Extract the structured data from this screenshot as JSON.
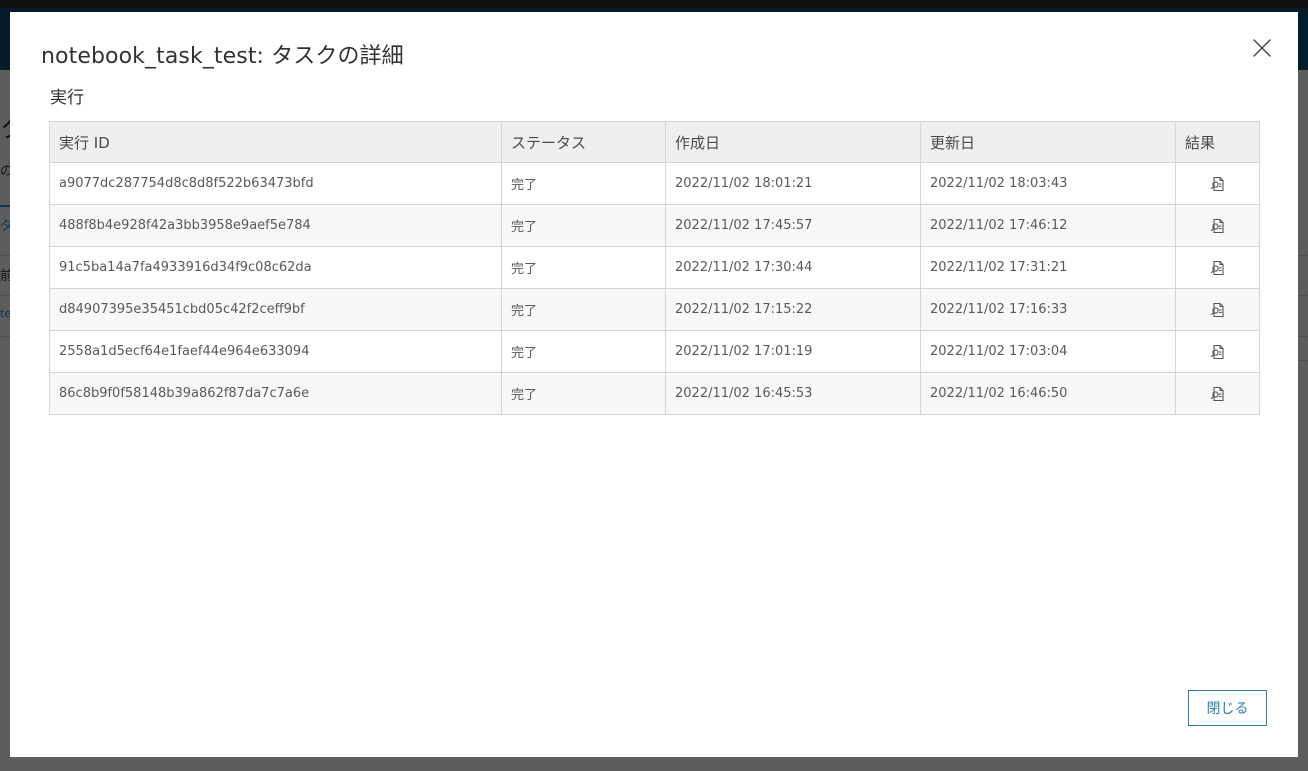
{
  "background": {
    "left_fragments": [
      "ク",
      "の",
      "タ",
      "前",
      "te"
    ]
  },
  "dialog": {
    "title": "notebook_task_test: タスクの詳細",
    "close_icon": "close-icon",
    "section_label": "実行",
    "table": {
      "headers": {
        "run_id": "実行 ID",
        "status": "ステータス",
        "created": "作成日",
        "updated": "更新日",
        "result": "結果"
      },
      "result_icon": "view-result-icon",
      "rows": [
        {
          "run_id": "a9077dc287754d8c8d8f522b63473bfd",
          "status": "完了",
          "created": "2022/11/02 18:01:21",
          "updated": "2022/11/02 18:03:43"
        },
        {
          "run_id": "488f8b4e928f42a3bb3958e9aef5e784",
          "status": "完了",
          "created": "2022/11/02 17:45:57",
          "updated": "2022/11/02 17:46:12"
        },
        {
          "run_id": "91c5ba14a7fa4933916d34f9c08c62da",
          "status": "完了",
          "created": "2022/11/02 17:30:44",
          "updated": "2022/11/02 17:31:21"
        },
        {
          "run_id": "d84907395e35451cbd05c42f2ceff9bf",
          "status": "完了",
          "created": "2022/11/02 17:15:22",
          "updated": "2022/11/02 17:16:33"
        },
        {
          "run_id": "2558a1d5ecf64e1faef44e964e633094",
          "status": "完了",
          "created": "2022/11/02 17:01:19",
          "updated": "2022/11/02 17:03:04"
        },
        {
          "run_id": "86c8b9f0f58148b39a862f87da7c7a6e",
          "status": "完了",
          "created": "2022/11/02 16:45:53",
          "updated": "2022/11/02 16:46:50"
        }
      ]
    },
    "close_button_label": "閉じる",
    "colors": {
      "accent": "#2f7fb0",
      "header_bg": "#efefef",
      "border": "#d4d4d4"
    }
  }
}
